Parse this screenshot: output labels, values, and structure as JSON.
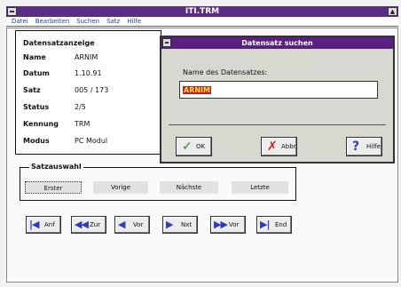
{
  "window": {
    "title": "ITI.TRM",
    "maximize_icon": "▲"
  },
  "menubar": [
    "Datei",
    "Bearbeiten",
    "Suchen",
    "Satz",
    "Hilfe"
  ],
  "info": {
    "heading": "Datensatzanzeige",
    "rows": [
      {
        "label": "Name",
        "value": "ARNIM"
      },
      {
        "label": "Datum",
        "value": "1.10.91"
      },
      {
        "label": "Satz",
        "value": "005 / 173"
      },
      {
        "label": "Status",
        "value": "2/5"
      },
      {
        "label": "Kennung",
        "value": "TRM"
      },
      {
        "label": "Modus",
        "value": "PC Modul"
      }
    ]
  },
  "dialog": {
    "title": "Datensatz suchen",
    "prompt": "Name des Datensatzes:",
    "input_value": "ARNIM",
    "buttons": [
      {
        "glyph": "✓",
        "label": "OK",
        "color": "#1a8a1a"
      },
      {
        "glyph": "✗",
        "label": "Abbr.",
        "color": "#c42121"
      },
      {
        "glyph": "?",
        "label": "Hilfe",
        "color": "#2a3fb8"
      }
    ]
  },
  "radio_group": {
    "caption": "Satzauswahl",
    "buttons": [
      "Erster",
      "Vorige",
      "Nächste",
      "Letzte"
    ]
  },
  "nav_buttons": [
    {
      "glyph": "|◀",
      "label": "Anf",
      "icon": "first-record-icon"
    },
    {
      "glyph": "◀◀",
      "label": "Zur",
      "icon": "rewind-icon"
    },
    {
      "glyph": "◀",
      "label": "Vor",
      "icon": "prev-icon"
    },
    {
      "glyph": "▶",
      "label": "Nxt",
      "icon": "next-icon"
    },
    {
      "glyph": "▶▶",
      "label": "Vor",
      "icon": "fast-forward-icon"
    },
    {
      "glyph": "▶|",
      "label": "End",
      "icon": "last-record-icon"
    }
  ]
}
